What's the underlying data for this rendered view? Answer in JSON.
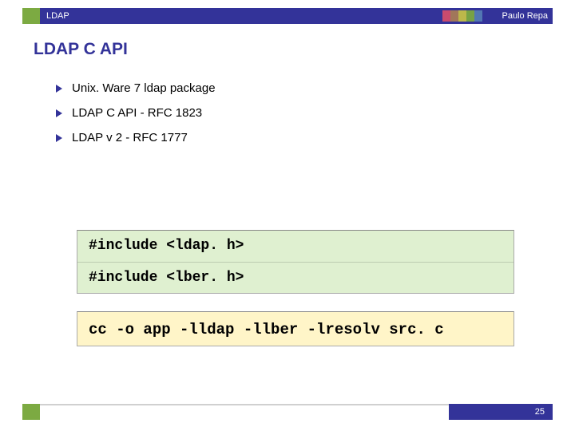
{
  "header": {
    "tag": "LDAP",
    "author": "Paulo Repa"
  },
  "title": "LDAP C API",
  "bullets": [
    "Unix. Ware 7 ldap package",
    "LDAP C API - RFC 1823",
    "LDAP v 2 - RFC 1777"
  ],
  "code": {
    "includes": [
      "#include <ldap. h>",
      "#include <lber. h>"
    ],
    "compile": "cc -o app -lldap -llber -lresolv src. c"
  },
  "footer": {
    "page": "25"
  }
}
